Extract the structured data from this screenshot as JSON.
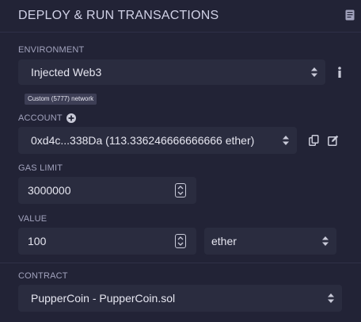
{
  "panel": {
    "title": "DEPLOY & RUN TRANSACTIONS",
    "doc_icon": "book-icon"
  },
  "environment": {
    "label": "ENVIRONMENT",
    "value": "Injected Web3",
    "network_badge": "Custom (5777) network",
    "info_icon": "info-icon"
  },
  "account": {
    "label": "ACCOUNT",
    "add_icon": "plus-circle-icon",
    "value": "0xd4c...338Da (113.336246666666666 ether)",
    "copy_icon": "copy-icon",
    "edit_icon": "edit-icon"
  },
  "gas_limit": {
    "label": "GAS LIMIT",
    "value": "3000000"
  },
  "value": {
    "label": "VALUE",
    "amount": "100",
    "unit": "ether"
  },
  "contract": {
    "label": "CONTRACT",
    "value": "PupperCoin - PupperCoin.sol"
  },
  "colors": {
    "background": "#222336",
    "field": "#2a2c3f",
    "text": "#e6e6f0",
    "label": "#a2a3bd"
  }
}
